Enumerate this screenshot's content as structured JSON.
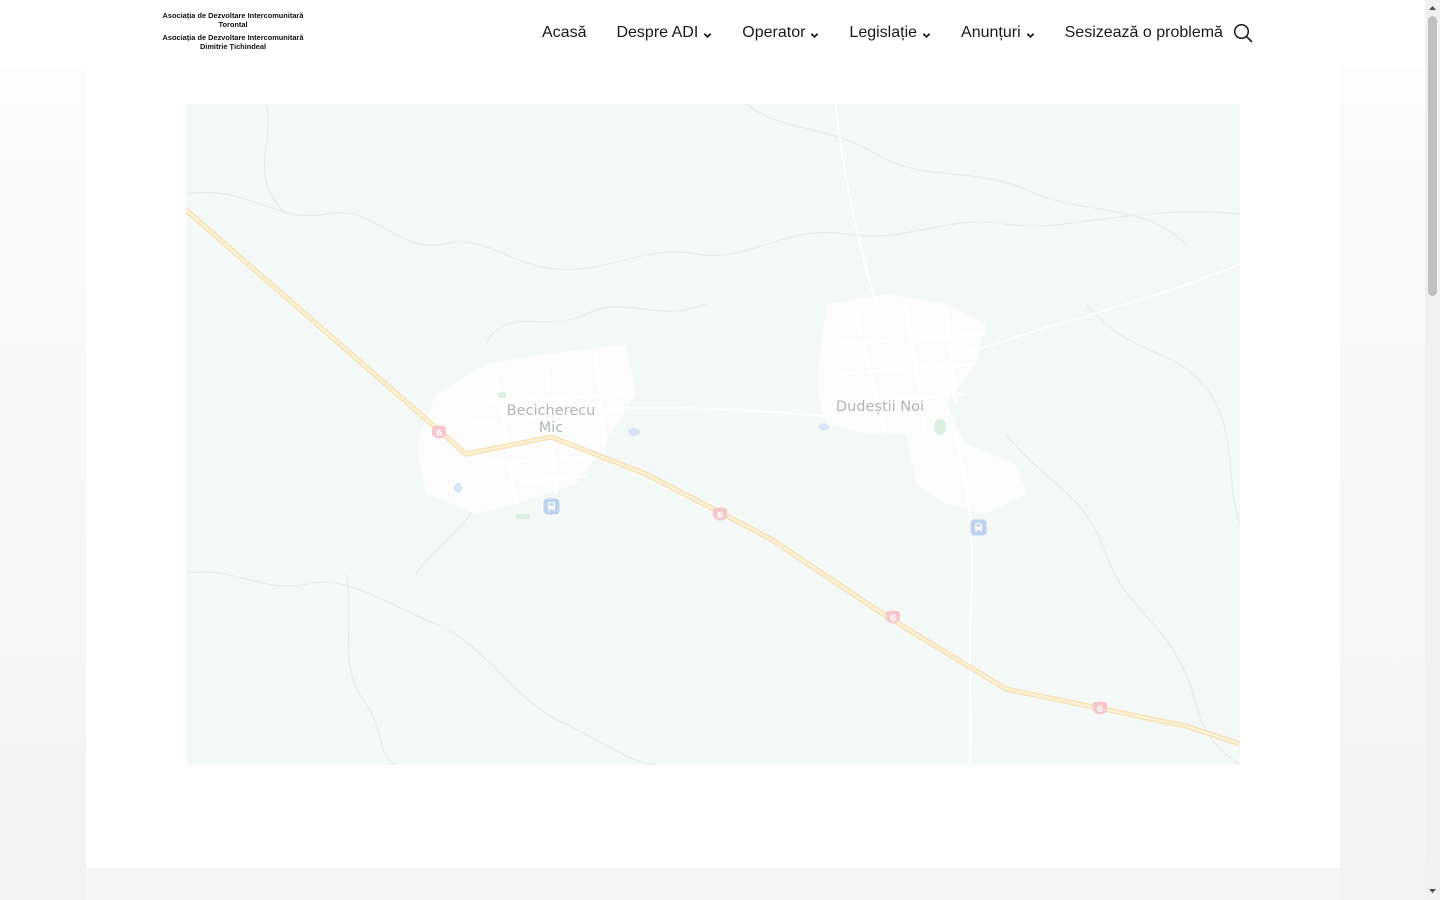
{
  "logo": {
    "line1a": "Asociația de Dezvoltare Intercomunitară",
    "line1b": "Torontal",
    "line2a": "Asociația de Dezvoltare Intercomunitară",
    "line2b": "Dimitrie Țichindeal"
  },
  "nav": {
    "items": [
      {
        "label": "Acasă",
        "dropdown": false
      },
      {
        "label": "Despre ADI",
        "dropdown": true
      },
      {
        "label": "Operator",
        "dropdown": true
      },
      {
        "label": "Legislație",
        "dropdown": true
      },
      {
        "label": "Anunțuri",
        "dropdown": true
      },
      {
        "label": "Sesizează o problemă",
        "dropdown": false
      }
    ],
    "search_icon": "search-icon"
  },
  "map": {
    "places": [
      {
        "name": "Becicherecu Mic",
        "line1": "Becicherecu",
        "line2": "Mic"
      },
      {
        "name": "Dudeștii Noi"
      }
    ],
    "road_shield": "6",
    "poi_icon": "train-station-icon"
  },
  "colors": {
    "map_bg": "#f4f8f6",
    "road": "#fbe7b8",
    "shield": "#f6c7cc",
    "label": "#b3b6b9"
  }
}
